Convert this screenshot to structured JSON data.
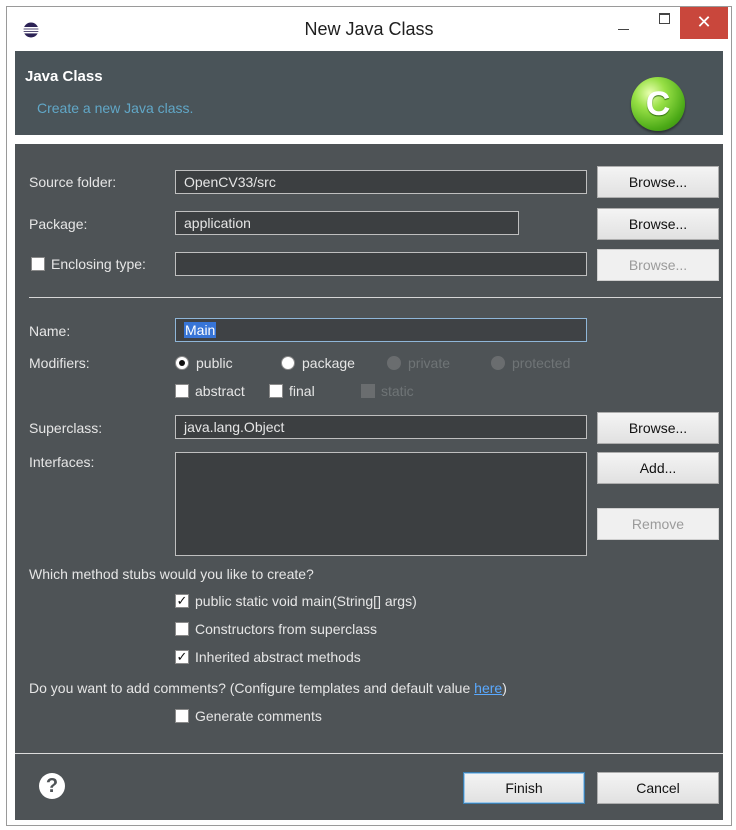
{
  "window": {
    "title": "New Java Class"
  },
  "header": {
    "title": "Java Class",
    "subtitle": "Create a new Java class."
  },
  "form": {
    "source_folder": {
      "label": "Source folder:",
      "value": "OpenCV33/src",
      "browse_label": "Browse..."
    },
    "package": {
      "label": "Package:",
      "value": "application",
      "browse_label": "Browse..."
    },
    "enclosing_type": {
      "label": "Enclosing type:",
      "checked": false,
      "value": "",
      "browse_label": "Browse..."
    },
    "name": {
      "label": "Name:",
      "value": "Main"
    },
    "modifiers": {
      "label": "Modifiers:",
      "public": "public",
      "package": "package",
      "private": "private",
      "protected": "protected",
      "abstract": "abstract",
      "final": "final",
      "static": "static",
      "selected": "public"
    },
    "superclass": {
      "label": "Superclass:",
      "value": "java.lang.Object",
      "browse_label": "Browse..."
    },
    "interfaces": {
      "label": "Interfaces:",
      "add_label": "Add...",
      "remove_label": "Remove"
    },
    "stubs": {
      "question": "Which method stubs would you like to create?",
      "main": {
        "label": "public static void main(String[] args)",
        "checked": true
      },
      "constructors": {
        "label": "Constructors from superclass",
        "checked": false
      },
      "inherited": {
        "label": "Inherited abstract methods",
        "checked": true
      }
    },
    "comments": {
      "question_prefix": "Do you want to add comments? (Configure templates and default value ",
      "link": "here",
      "question_suffix": ")",
      "generate": {
        "label": "Generate comments",
        "checked": false
      }
    }
  },
  "footer": {
    "finish_label": "Finish",
    "cancel_label": "Cancel"
  },
  "icons": {
    "help": "help-icon",
    "logo": "java-class-icon",
    "app": "eclipse-icon"
  },
  "colors": {
    "panel": "#4e5356",
    "header": "#4a5459",
    "accent": "#61a7c7",
    "close": "#c9473c"
  }
}
